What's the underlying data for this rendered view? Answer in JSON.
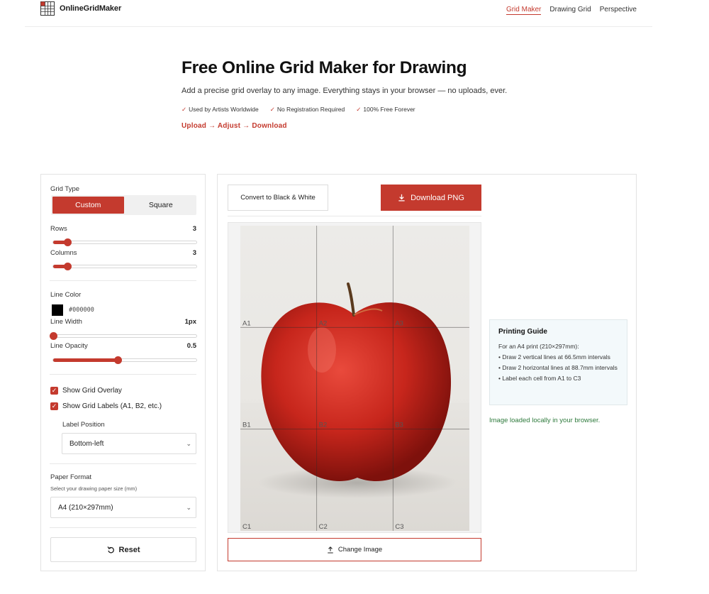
{
  "brand": {
    "name": "OnlineGridMaker"
  },
  "nav": [
    {
      "label": "Grid Maker",
      "active": true
    },
    {
      "label": "Drawing Grid",
      "active": false
    },
    {
      "label": "Perspective",
      "active": false
    }
  ],
  "hero": {
    "title": "Free Online Grid Maker for Drawing",
    "subtitle": "Add a precise grid overlay to any image. Everything stays in your browser — no uploads, ever.",
    "badges": [
      "Used by Artists Worldwide",
      "No Registration Required",
      "100% Free Forever"
    ],
    "flow": "Upload → Adjust → Download"
  },
  "controls": {
    "grid_type_label": "Grid Type",
    "grid_types": [
      "Custom",
      "Square"
    ],
    "grid_type_selected": "Custom",
    "rows_label": "Rows",
    "rows_value": "3",
    "rows_fraction": 0.1,
    "columns_label": "Columns",
    "columns_value": "3",
    "columns_fraction": 0.1,
    "line_color_label": "Line Color",
    "line_color_value": "#000000",
    "line_width_label": "Line Width",
    "line_width_value": "1px",
    "line_width_fraction": 0,
    "line_opacity_label": "Line Opacity",
    "line_opacity_value": "0.5",
    "line_opacity_fraction": 0.45,
    "show_overlay_label": "Show Grid Overlay",
    "show_overlay_checked": true,
    "show_labels_label": "Show Grid Labels (A1, B2, etc.)",
    "show_labels_checked": true,
    "label_position_label": "Label Position",
    "label_position_value": "Bottom-left",
    "paper_format_label": "Paper Format",
    "paper_format_hint": "Select your drawing paper size (mm)",
    "paper_format_value": "A4 (210×297mm)",
    "reset_label": "Reset"
  },
  "actions": {
    "bw_label": "Convert to Black & White",
    "download_label": "Download PNG",
    "change_label": "Change Image"
  },
  "grid": {
    "rows": 3,
    "cols": 3,
    "labels": [
      [
        "A1",
        "A2",
        "A3"
      ],
      [
        "B1",
        "B2",
        "B3"
      ],
      [
        "C1",
        "C2",
        "C3"
      ]
    ]
  },
  "guide": {
    "title": "Printing Guide",
    "lines": [
      "For an A4 print (210×297mm):",
      "• Draw 2 vertical lines at 66.5mm intervals",
      "• Draw 2 horizontal lines at 88.7mm intervals",
      "• Label each cell from A1 to C3"
    ]
  },
  "status": "Image loaded locally in your browser.",
  "colors": {
    "accent": "#c43a2e",
    "status": "#2e7a3c"
  }
}
